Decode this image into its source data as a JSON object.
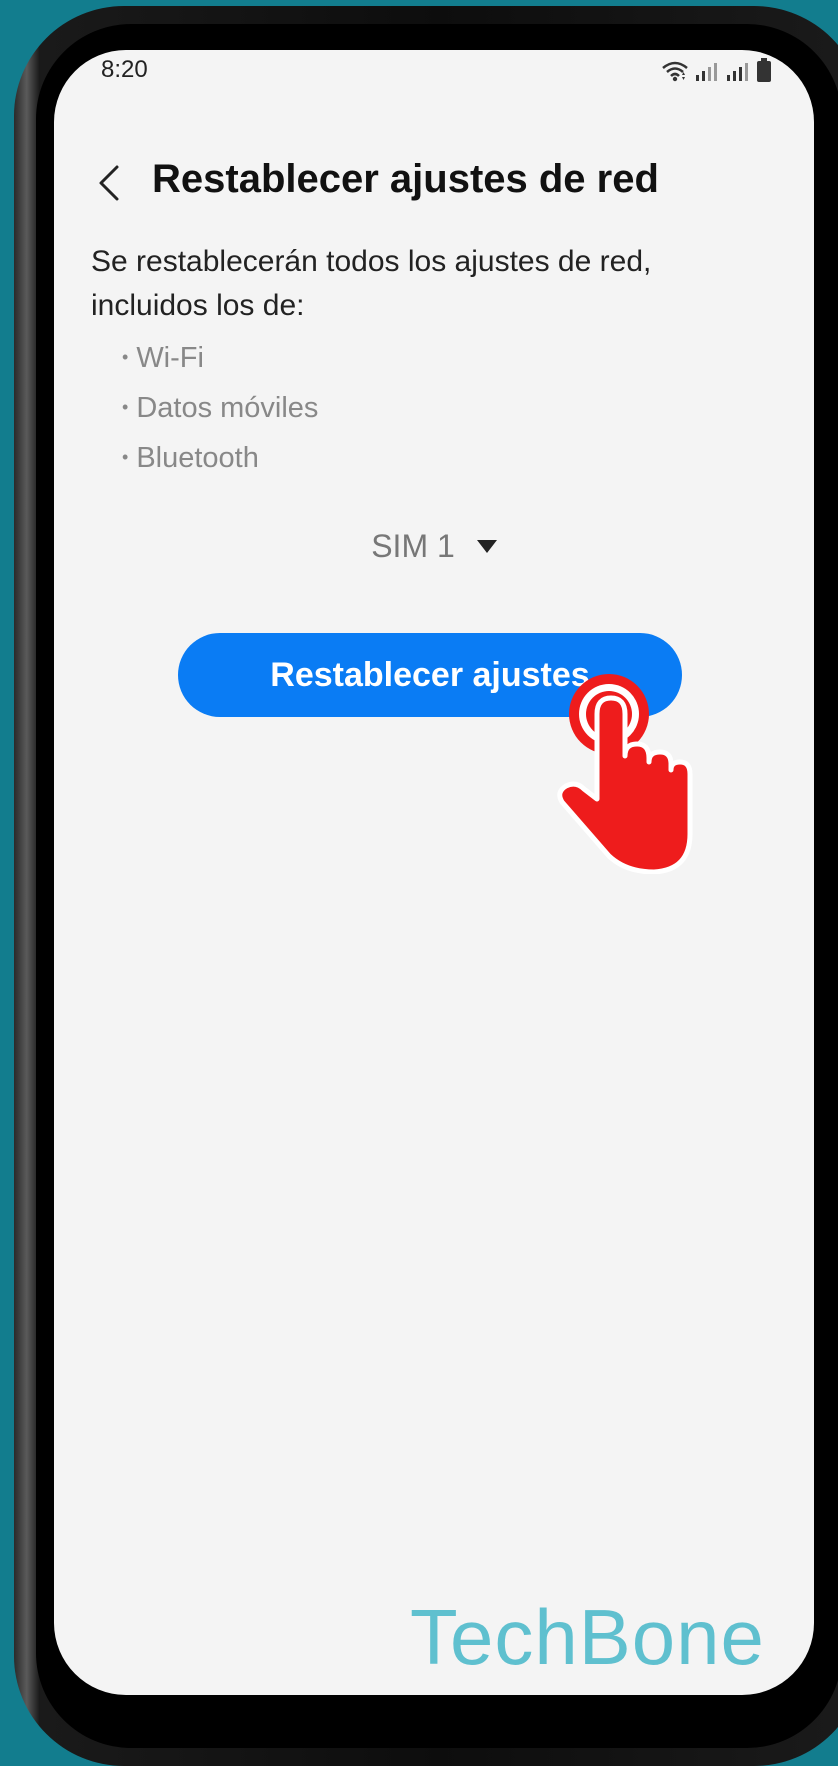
{
  "status_bar": {
    "time": "8:20"
  },
  "header": {
    "title": "Restablecer ajustes de red"
  },
  "description": "Se restablecerán todos los ajustes de red, incluidos los de:",
  "bullets": [
    "Wi-Fi",
    "Datos móviles",
    "Bluetooth"
  ],
  "sim_select": {
    "value": "SIM 1"
  },
  "reset_button": {
    "label": "Restablecer ajustes"
  },
  "watermark": "TechBone",
  "colors": {
    "background": "#127d8e",
    "screen": "#f4f4f4",
    "accent": "#0a7cf4",
    "tap_indicator": "#ee1c1c",
    "watermark": "#5fc0cf"
  },
  "icons": [
    "wifi-icon",
    "signal-icon",
    "battery-icon",
    "back-arrow-icon",
    "dropdown-arrow-icon",
    "tap-hand-icon"
  ]
}
